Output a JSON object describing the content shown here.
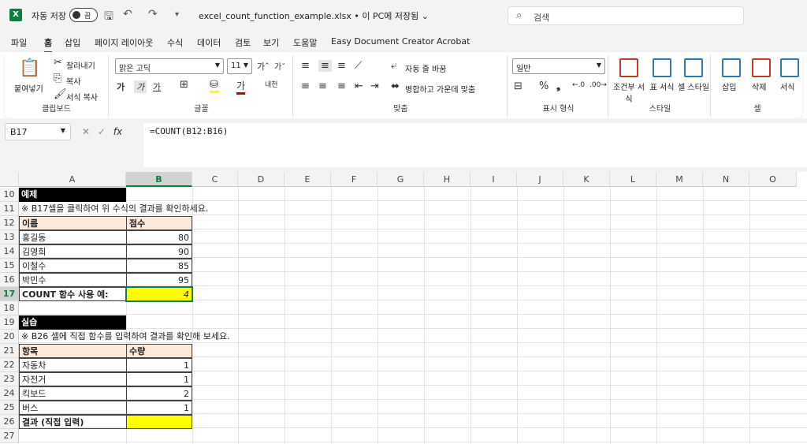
{
  "titlebar": {
    "logo": "X",
    "autosave_label": "자동 저장",
    "autosave_state": "끔",
    "filename": "excel_count_function_example.xlsx • 이 PC에 저장됨 ⌄",
    "search_placeholder": "검색"
  },
  "menu": [
    "파일",
    "홈",
    "삽입",
    "페이지 레이아웃",
    "수식",
    "데이터",
    "검토",
    "보기",
    "도움말",
    "Easy Document Creator",
    "Acrobat"
  ],
  "menu_active": "홈",
  "ribbon": {
    "clipboard": {
      "paste": "붙여넣기",
      "cut": "잘라내기",
      "copy": "복사",
      "format_painter": "서식 복사",
      "label": "클립보드"
    },
    "font": {
      "name": "맑은 고딕",
      "size": "11",
      "label": "글꼴",
      "bold": "가",
      "italic": "가",
      "underline": "가"
    },
    "alignment": {
      "wrap": "자동 줄 바꿈",
      "merge": "병합하고 가운데 맞춤",
      "label": "맞춤"
    },
    "number": {
      "format": "일반",
      "label": "표시 형식"
    },
    "styles": {
      "conditional": "조건부 서식",
      "table": "표 서식",
      "cell": "셀 스타일",
      "label": "스타일"
    },
    "cells": {
      "insert": "삽입",
      "delete": "삭제",
      "format": "서식",
      "label": "셀"
    }
  },
  "formula_bar": {
    "namebox": "B17",
    "fx": "fx",
    "formula": "=COUNT(B12:B16)"
  },
  "columns": [
    "A",
    "B",
    "C",
    "D",
    "E",
    "F",
    "G",
    "H",
    "I",
    "J",
    "K",
    "L",
    "M",
    "N",
    "O"
  ],
  "rows": [
    "10",
    "11",
    "12",
    "13",
    "14",
    "15",
    "16",
    "17",
    "18",
    "19",
    "20",
    "21",
    "22",
    "23",
    "24",
    "25",
    "26",
    "27"
  ],
  "cells": {
    "a10": "예제",
    "a11": "※ B17셀을 클릭하여 위 수식의 결과를 확인하세요.",
    "a12": "이름",
    "b12": "점수",
    "a13": "홍길동",
    "b13": "80",
    "a14": "김영희",
    "b14": "90",
    "a15": "이철수",
    "b15": "85",
    "a16": "박민수",
    "b16": "95",
    "a17": "COUNT 함수 사용 예:",
    "b17": "4",
    "a19": "실습",
    "a20": "※ B26 셀에 직접 함수를 입력하여 결과를 확인해 보세요.",
    "a21": "항목",
    "b21": "수량",
    "a22": "자동차",
    "b22": "1",
    "a23": "자전거",
    "b23": "1",
    "a24": "킥보드",
    "b24": "2",
    "a25": "버스",
    "b25": "1",
    "a26": "결과 (직접 입력)"
  },
  "colors": {
    "accent": "#107c41",
    "header_fill": "#fde9d9",
    "highlight": "#ffff00"
  }
}
